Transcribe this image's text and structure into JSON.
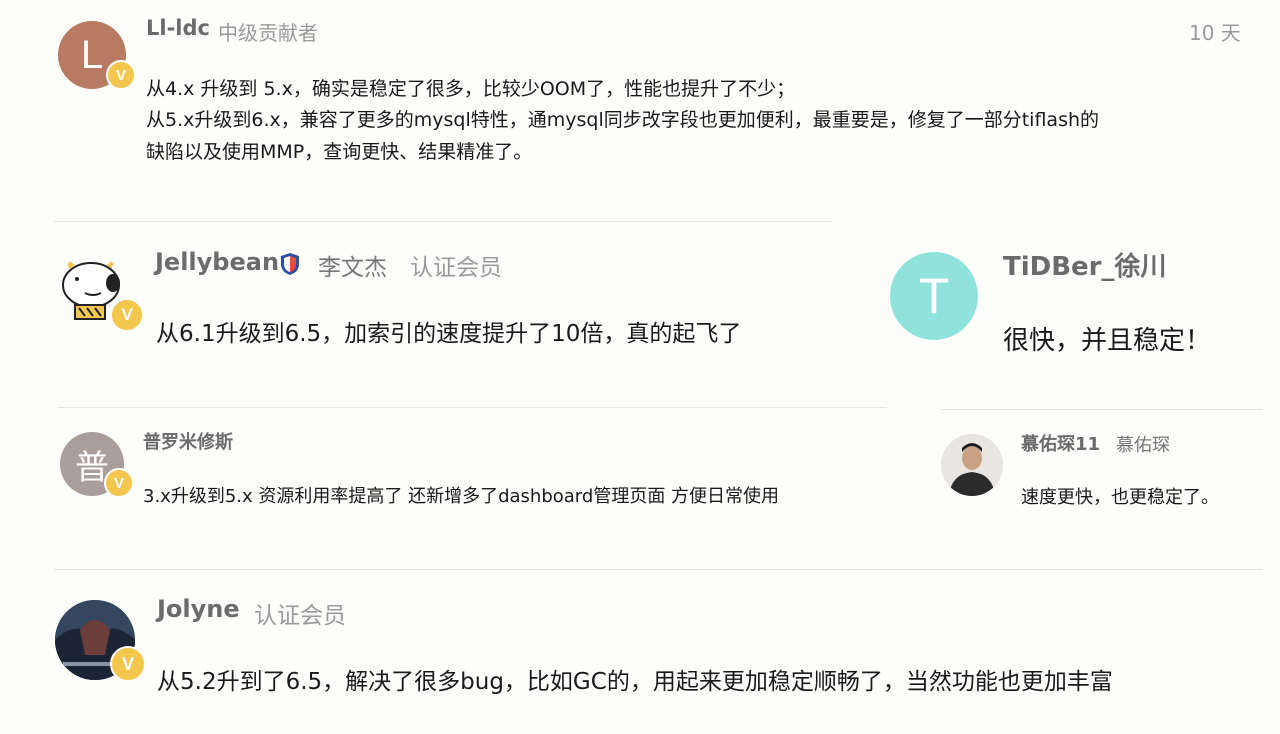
{
  "comments": [
    {
      "id": "c1",
      "avatar_letter": "L",
      "avatar_color": "#b87a62",
      "username": "Ll-ldc",
      "role": "中级贡献者",
      "time": "10 天",
      "lines": [
        "从4.x 升级到 5.x，确实是稳定了很多，比较少OOM了，性能也提升了不少；",
        "从5.x升级到6.x，兼容了更多的mysql特性，通mysql同步改字段也更加便利，最重要是，修复了一部分tiflash的",
        "缺陷以及使用MMP，查询更快、结果精准了。"
      ]
    },
    {
      "id": "c2",
      "username": "Jellybean",
      "real_name": "李文杰",
      "role": "认证会员",
      "lines": [
        "从6.1升级到6.5，加索引的速度提升了10倍，真的起飞了"
      ]
    },
    {
      "id": "c3",
      "avatar_letter": "T",
      "avatar_color": "#8fe3dc",
      "username": "TiDBer_徐川",
      "lines": [
        "很快，并且稳定！"
      ]
    },
    {
      "id": "c4",
      "avatar_letter": "普",
      "avatar_color": "#a99e9a",
      "username": "普罗米修斯",
      "lines": [
        "3.x升级到5.x 资源利用率提高了 还新增多了dashboard管理页面 方便日常使用"
      ]
    },
    {
      "id": "c5",
      "username": "慕佑琛11",
      "real_name": "慕佑琛",
      "lines": [
        "速度更快，也更稳定了。"
      ]
    },
    {
      "id": "c6",
      "username": "Jolyne",
      "role": "认证会员",
      "lines": [
        "从5.2升到了6.5，解决了很多bug，比如GC的，用起来更加稳定顺畅了，当然功能也更加丰富"
      ]
    }
  ],
  "badge_letter": "V",
  "colors": {
    "badge": "#f3c64d",
    "name": "#6b6b6b",
    "tag": "#9a9a9a",
    "body": "#1a1a1a"
  }
}
